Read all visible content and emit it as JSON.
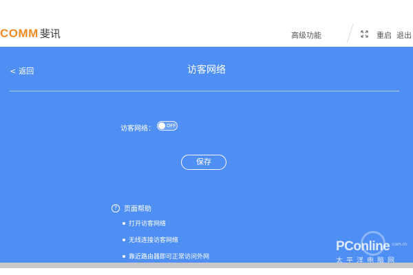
{
  "header": {
    "logo_brand": "COMM",
    "logo_cn": "斐讯",
    "nav_advanced": "高级功能",
    "nav_restart": "重启",
    "nav_exit": "退出",
    "fullscreen_icon": "fullscreen-icon"
  },
  "main": {
    "back_label": "返回",
    "back_chevron": "<",
    "title": "访客网络",
    "toggle_label": "访客网络：",
    "toggle_state": "OFF",
    "save_label": "保存",
    "help_icon_glyph": "?",
    "help_title": "页面帮助",
    "help_items": [
      "打开访客网络",
      "无线连接访客网络",
      "靠近路由器即可正常访问外网"
    ]
  },
  "watermark": {
    "brand": "PConline",
    "domain": ".com.cn",
    "cn": "太平洋电脑网"
  },
  "colors": {
    "accent": "#f08a24",
    "panel": "#4f8ff3",
    "footer": "#c8c8c8"
  }
}
